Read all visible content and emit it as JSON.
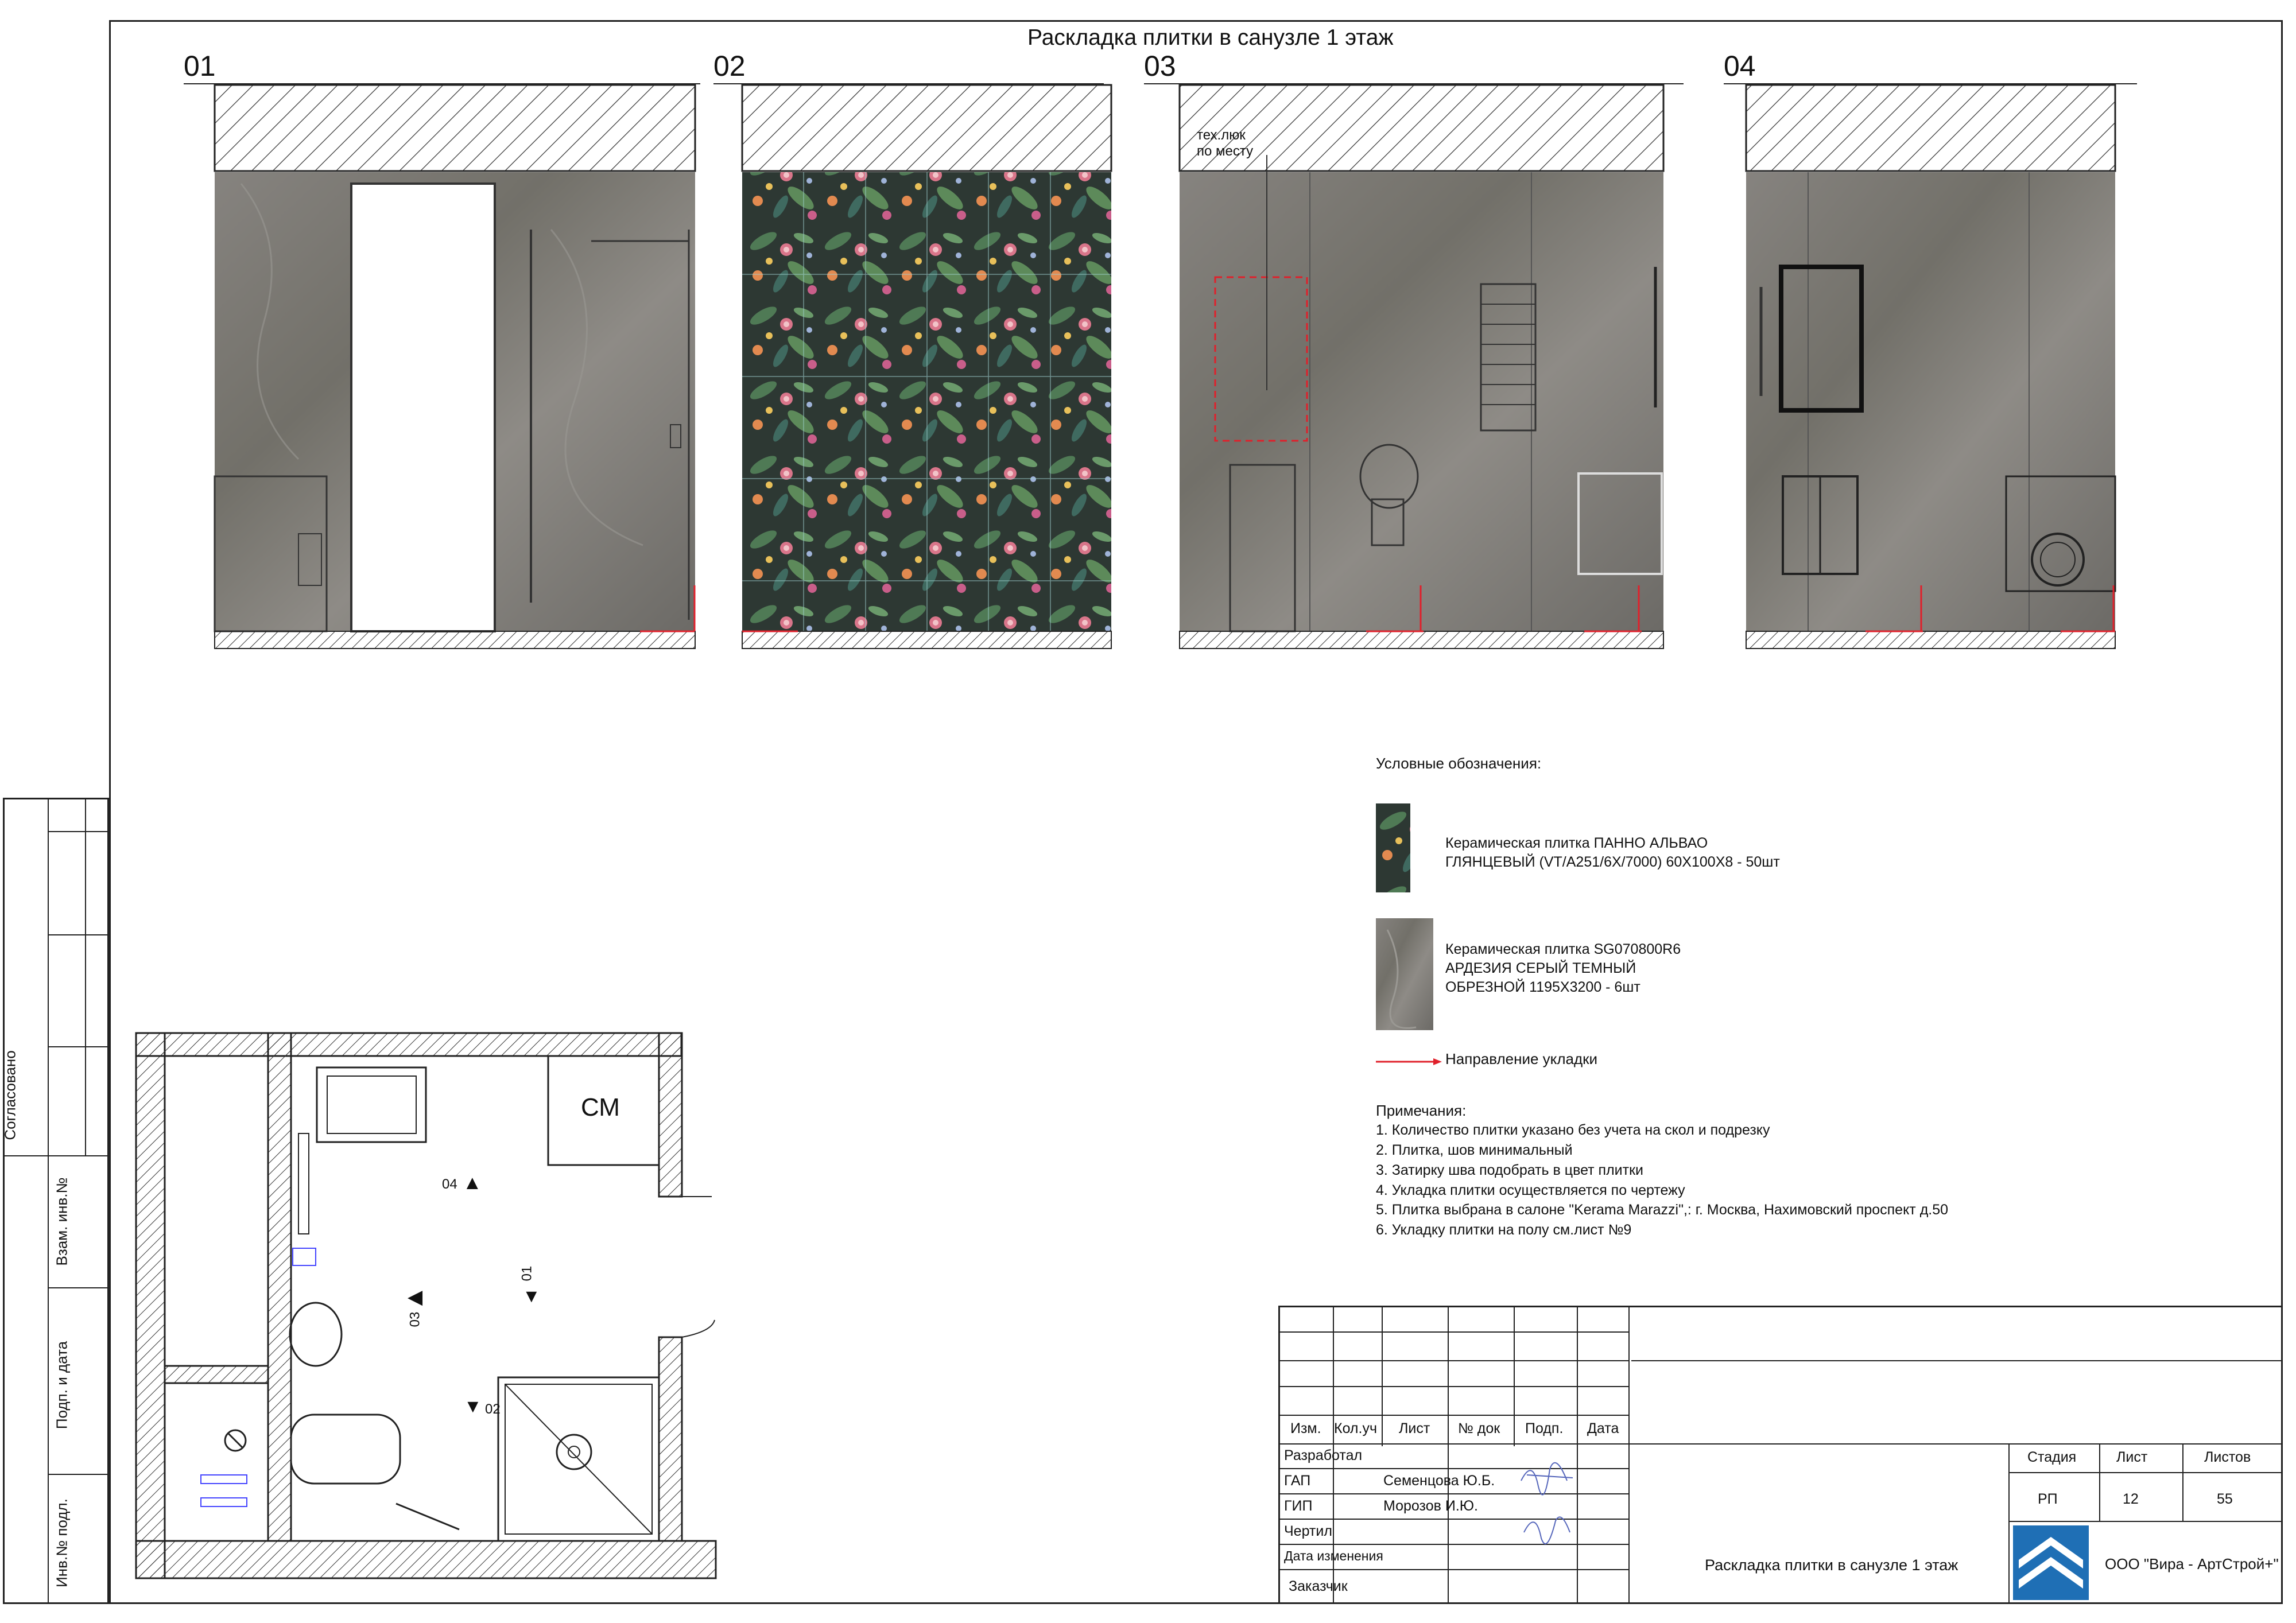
{
  "title": "Раскладка плитки в санузле 1 этаж",
  "views": [
    {
      "number": "01"
    },
    {
      "number": "02"
    },
    {
      "number": "03",
      "annotation_line1": "тех.люк",
      "annotation_line2": "по месту"
    },
    {
      "number": "04"
    }
  ],
  "plan": {
    "washer_label": "СМ",
    "markers": [
      {
        "number": "04",
        "arrow": "▲"
      },
      {
        "number": "01",
        "arrow": "▼"
      },
      {
        "number": "03",
        "arrow": "◀"
      },
      {
        "number": "02",
        "arrow": "▼"
      }
    ]
  },
  "legend": {
    "heading": "Условные обозначения:",
    "item1_line1": "Керамическая плитка ПАННО АЛЬВАО",
    "item1_line2": "ГЛЯНЦЕВЫЙ (VT/A251/6X/7000) 60Х100Х8 - 50шт",
    "item2_line1": "Керамическая плитка SG070800R6",
    "item2_line2": "АРДЕЗИЯ СЕРЫЙ ТЕМНЫЙ",
    "item2_line3": "ОБРЕЗНОЙ 1195Х3200 - 6шт",
    "item3": "Направление укладки"
  },
  "notes": {
    "heading": "Примечания:",
    "items": [
      "1. Количество плитки  указано  без учета на скол и подрезку",
      "2. Плитка, шов минимальный",
      "3. Затирку шва подобрать в цвет плитки",
      "4. Укладка плитки осуществляется по чертежу",
      "5. Плитка выбрана в салоне \"Kerama Marazzi\",: г. Москва, Нахимовский проспект д.50",
      "6. Укладку плитки на полу см.лист №9"
    ]
  },
  "side_stamp": {
    "agreed": "Согласовано",
    "swap_inv": "Взам. инв.№",
    "sign_date": "Подп. и дата",
    "inv_no": "Инв.№ подл."
  },
  "title_block": {
    "col_headers": [
      "Изм.",
      "Кол.уч",
      "Лист",
      "№ док",
      "Подп.",
      "Дата"
    ],
    "rows": [
      {
        "role": "Разработал",
        "name": ""
      },
      {
        "role": "ГАП",
        "name": "Семенцова Ю.Б."
      },
      {
        "role": "ГИП",
        "name": "Морозов И.Ю."
      },
      {
        "role": "Чертил",
        "name": ""
      },
      {
        "role": "Дата изменения",
        "name": ""
      },
      {
        "role": "Заказчик",
        "name": ""
      }
    ],
    "stage_label": "Стадия",
    "sheet_label": "Лист",
    "sheets_label": "Листов",
    "stage": "РП",
    "sheet": "12",
    "sheets": "55",
    "drawing_title": "Раскладка плитки в санузле 1 этаж",
    "company": "ООО \"Вира - АртСтрой+\""
  },
  "colors": {
    "marble": "#7d7b78",
    "floral_bg": "#2e3a35",
    "accent_red": "#e0202b",
    "logo_blue": "#1f6fb5"
  }
}
